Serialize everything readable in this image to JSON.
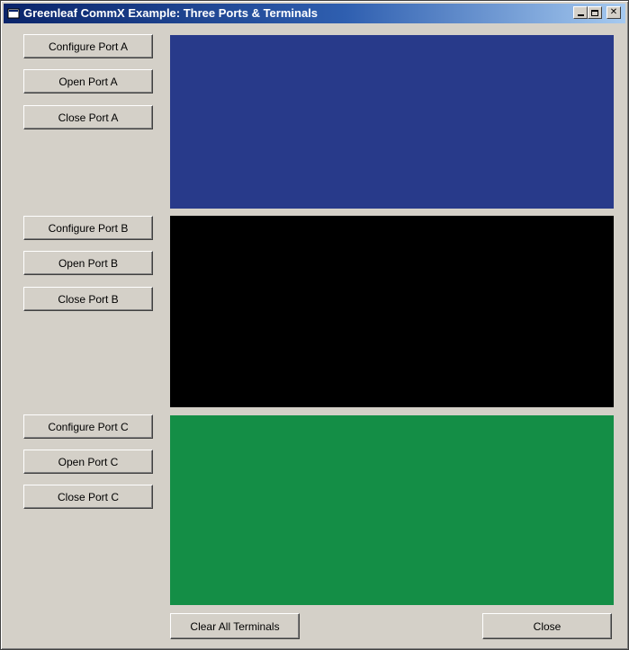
{
  "window": {
    "title": "Greenleaf CommX Example: Three Ports & Terminals",
    "icon": "app-window-icon"
  },
  "ports": [
    {
      "configure_label": "Configure Port A",
      "open_label": "Open Port A",
      "close_label": "Close Port A",
      "terminal_color": "#283a8a"
    },
    {
      "configure_label": "Configure Port B",
      "open_label": "Open Port B",
      "close_label": "Close Port B",
      "terminal_color": "#000000"
    },
    {
      "configure_label": "Configure Port C",
      "open_label": "Open Port C",
      "close_label": "Close Port C",
      "terminal_color": "#148e46"
    }
  ],
  "footer": {
    "clear_label": "Clear All Terminals",
    "close_label": "Close"
  },
  "colors": {
    "face": "#d4d0c8",
    "title_start": "#0a246a",
    "title_end": "#a6caf0"
  }
}
